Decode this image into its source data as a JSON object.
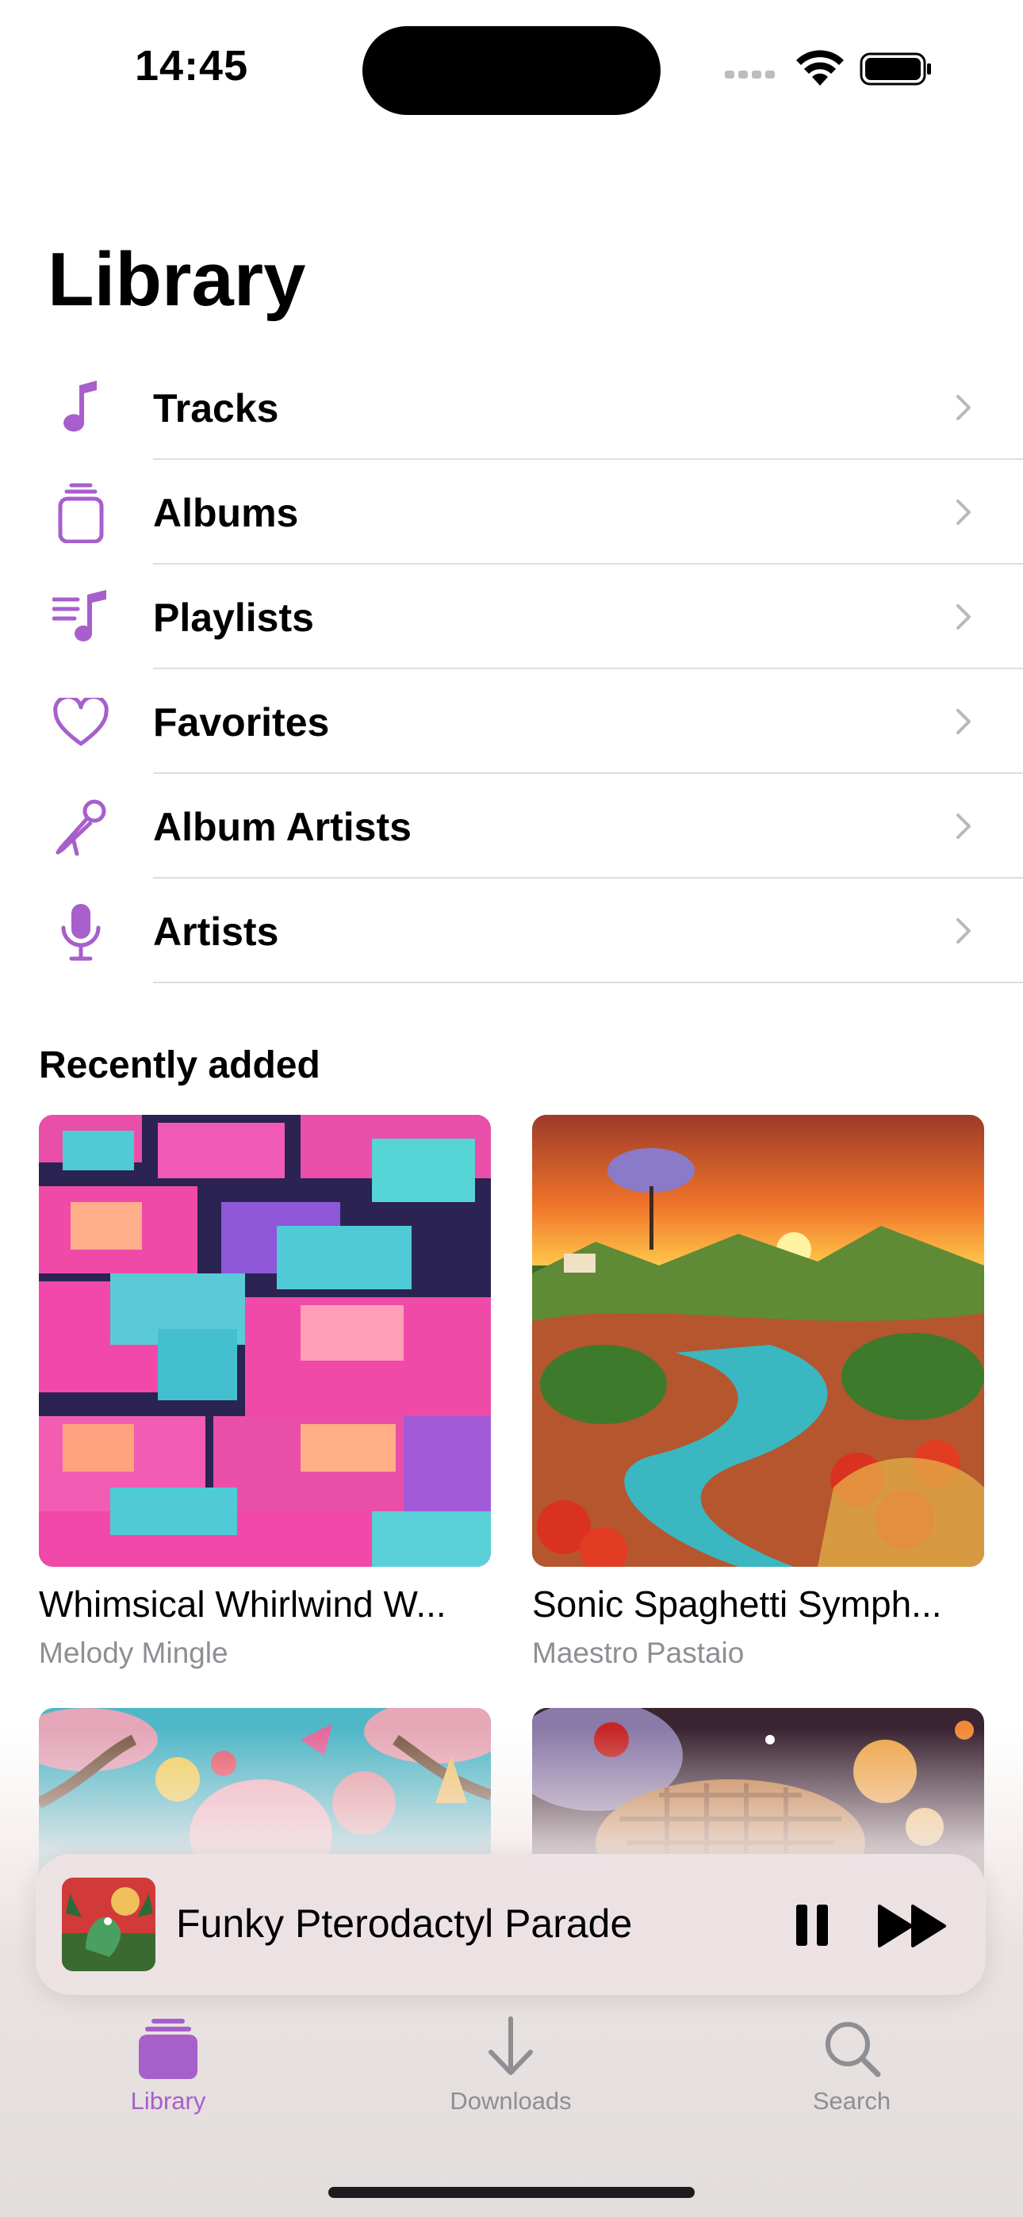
{
  "status_bar": {
    "time": "14:45"
  },
  "header": {
    "title": "Library"
  },
  "menu": [
    {
      "label": "Tracks",
      "icon": "music-note-icon"
    },
    {
      "label": "Albums",
      "icon": "albums-stack-icon"
    },
    {
      "label": "Playlists",
      "icon": "playlist-icon"
    },
    {
      "label": "Favorites",
      "icon": "heart-icon"
    },
    {
      "label": "Album Artists",
      "icon": "microphone-stand-icon"
    },
    {
      "label": "Artists",
      "icon": "microphone-icon"
    }
  ],
  "recently_added": {
    "title": "Recently added",
    "items": [
      {
        "title": "Whimsical Whirlwind W...",
        "artist": "Melody Mingle"
      },
      {
        "title": "Sonic Spaghetti Symph...",
        "artist": "Maestro Pastaio"
      },
      {
        "title": "",
        "artist": ""
      },
      {
        "title": "",
        "artist": ""
      }
    ]
  },
  "now_playing": {
    "title": "Funky Pterodactyl Parade"
  },
  "tabs": [
    {
      "label": "Library",
      "icon": "library-icon",
      "active": true
    },
    {
      "label": "Downloads",
      "icon": "download-arrow-icon",
      "active": false
    },
    {
      "label": "Search",
      "icon": "search-icon",
      "active": false
    }
  ],
  "colors": {
    "accent": "#a75fcc",
    "inactive": "#8e8e93",
    "divider": "#dedede",
    "secondary_text": "#8e8e93"
  }
}
